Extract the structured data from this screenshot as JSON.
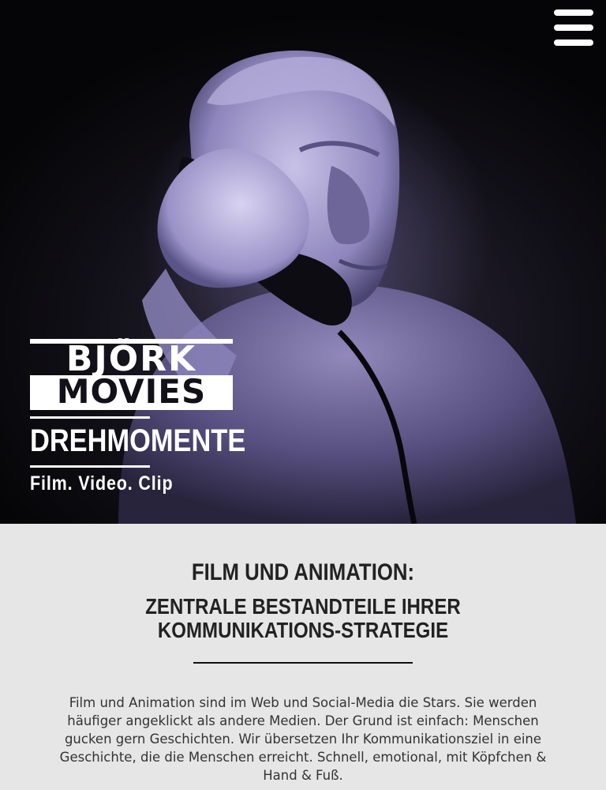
{
  "nav": {
    "menu_icon": "hamburger-menu-icon"
  },
  "hero": {
    "image_subject": "clay-figure-telephone-image",
    "logo": {
      "line1": "BJÖRK",
      "line2": "MOVIES"
    },
    "title": "DREHMOMENTE",
    "subtitle": "Film. Video. Clip"
  },
  "intro": {
    "headline": "FILM UND ANIMATION:",
    "subheadline": "ZENTRALE BESTANDTEILE IHRER KOMMUNIKATIONS-STRATEGIE",
    "body": "Film und Animation sind im Web und Social-Media die Stars. Sie werden häufiger angeklickt als andere Medien. Der Grund ist einfach: Menschen gucken gern Geschichten. Wir übersetzen Ihr Kommunikationsziel in eine Geschichte, die die Menschen erreicht. Schnell, emotional, mit Köpfchen & Hand & Fuß."
  },
  "colors": {
    "hero_tint": "#8a80c0",
    "content_bg": "#e6e6e6",
    "text_dark": "#222222",
    "text_body": "#333333"
  }
}
